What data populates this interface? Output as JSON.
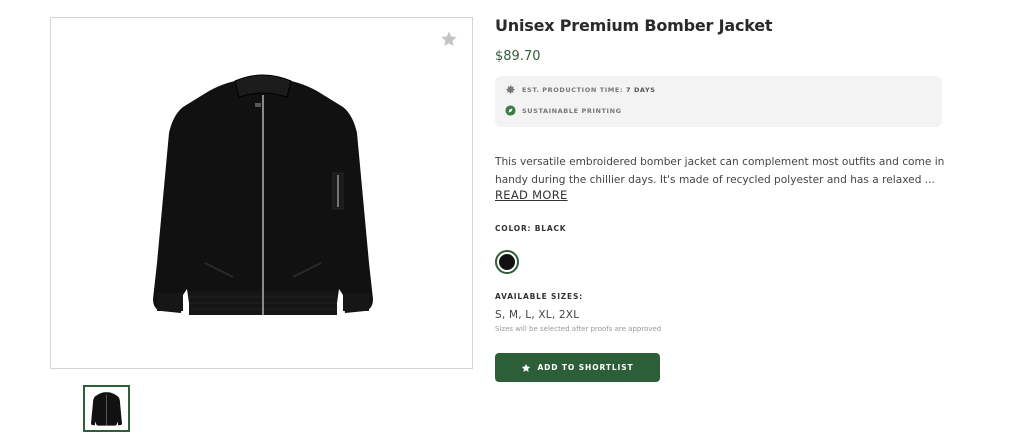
{
  "product": {
    "title": "Unisex Premium Bomber Jacket",
    "price": "$89.70",
    "image_alt_icon": "jacket-image"
  },
  "info": {
    "production_label": "EST. PRODUCTION TIME: ",
    "production_value": "7 DAYS",
    "production_icon": "gear-icon",
    "sustainable_label": "SUSTAINABLE PRINTING",
    "sustainable_icon": "leaf-icon"
  },
  "description": {
    "line1": "This versatile embroidered bomber jacket can complement most outfits and come in",
    "line2": "handy during the chillier days. It's made of recycled polyester and has a relaxed ...",
    "read_more": "READ MORE"
  },
  "color": {
    "label": "COLOR: BLACK",
    "swatch": "#111111"
  },
  "sizes": {
    "label": "AVAILABLE SIZES:",
    "value": "S, M, L, XL, 2XL",
    "note": "Sizes will be selected after proofs are approved"
  },
  "cta": {
    "label": "ADD TO SHORTLIST",
    "icon": "star-icon"
  },
  "colors": {
    "accent": "#2f5e3a",
    "button": "#2c5e38"
  }
}
